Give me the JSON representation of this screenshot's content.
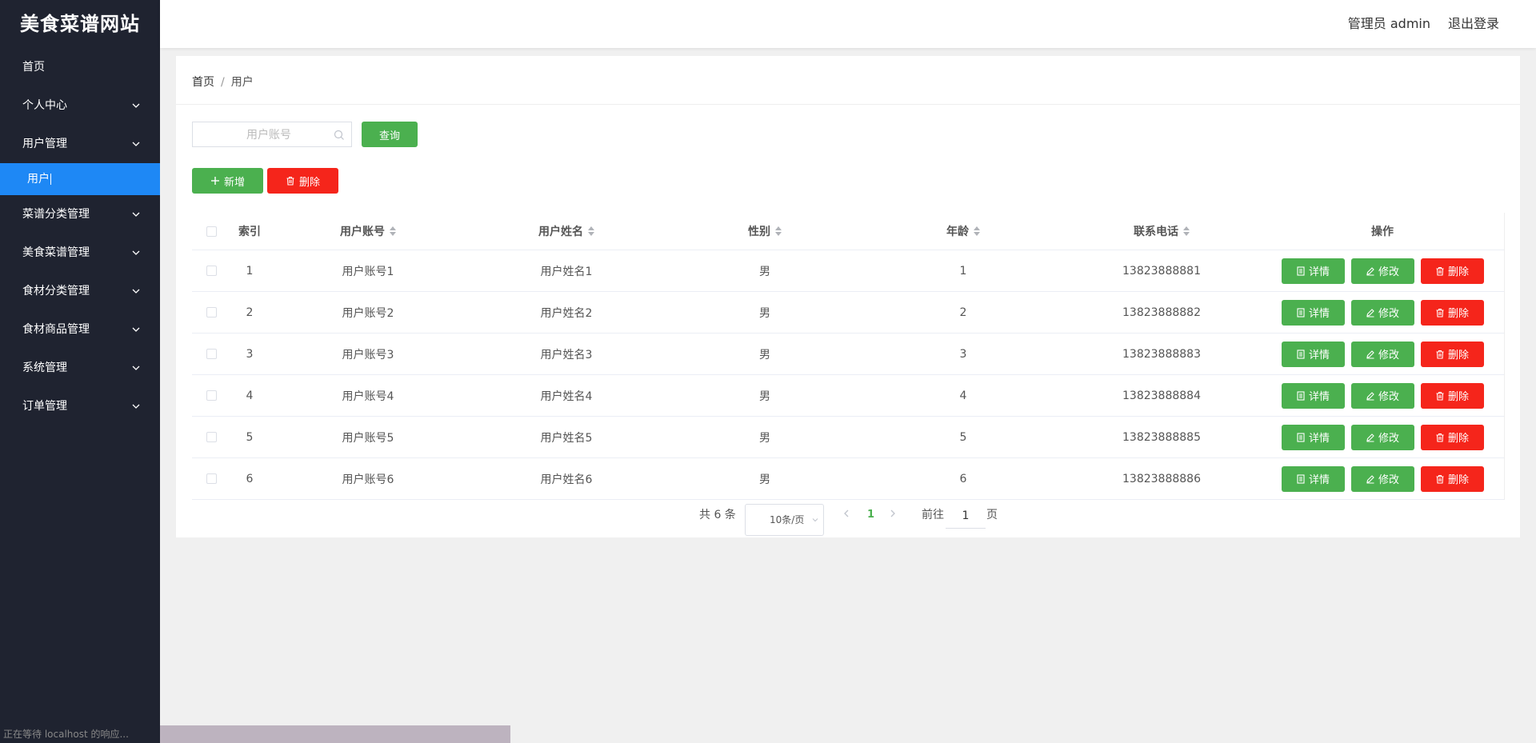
{
  "app": {
    "title": "美食菜谱网站"
  },
  "sidebar": {
    "items": [
      {
        "label": "首页",
        "expandable": false
      },
      {
        "label": "个人中心",
        "expandable": true
      },
      {
        "label": "用户管理",
        "expandable": true
      },
      {
        "label": "菜谱分类管理",
        "expandable": true
      },
      {
        "label": "美食菜谱管理",
        "expandable": true
      },
      {
        "label": "食材分类管理",
        "expandable": true
      },
      {
        "label": "食材商品管理",
        "expandable": true
      },
      {
        "label": "系统管理",
        "expandable": true
      },
      {
        "label": "订单管理",
        "expandable": true
      }
    ],
    "active_sub": "用户"
  },
  "header": {
    "user": "管理员 admin",
    "logout": "退出登录"
  },
  "breadcrumb": {
    "home": "首页",
    "current": "用户"
  },
  "search": {
    "placeholder": "用户账号",
    "value": "",
    "button": "查询"
  },
  "toolbar": {
    "add": "新增",
    "delete": "删除"
  },
  "table": {
    "columns": [
      "索引",
      "用户账号",
      "用户姓名",
      "性别",
      "年龄",
      "联系电话",
      "操作"
    ],
    "rows": [
      {
        "index": "1",
        "account": "用户账号1",
        "name": "用户姓名1",
        "gender": "男",
        "age": "1",
        "phone": "13823888881"
      },
      {
        "index": "2",
        "account": "用户账号2",
        "name": "用户姓名2",
        "gender": "男",
        "age": "2",
        "phone": "13823888882"
      },
      {
        "index": "3",
        "account": "用户账号3",
        "name": "用户姓名3",
        "gender": "男",
        "age": "3",
        "phone": "13823888883"
      },
      {
        "index": "4",
        "account": "用户账号4",
        "name": "用户姓名4",
        "gender": "男",
        "age": "4",
        "phone": "13823888884"
      },
      {
        "index": "5",
        "account": "用户账号5",
        "name": "用户姓名5",
        "gender": "男",
        "age": "5",
        "phone": "13823888885"
      },
      {
        "index": "6",
        "account": "用户账号6",
        "name": "用户姓名6",
        "gender": "男",
        "age": "6",
        "phone": "13823888886"
      }
    ],
    "actions": {
      "detail": "详情",
      "edit": "修改",
      "delete": "删除"
    }
  },
  "pagination": {
    "total": "共 6 条",
    "page_size": "10条/页",
    "current": "1",
    "goto": "前往",
    "goto_value": "1",
    "unit": "页"
  },
  "status_bar": {
    "text": "正在等待 localhost 的响应..."
  },
  "colors": {
    "sidebar": "#1f2330",
    "active": "#1e88f5",
    "green": "#4bb04f",
    "red": "#f5251b"
  }
}
